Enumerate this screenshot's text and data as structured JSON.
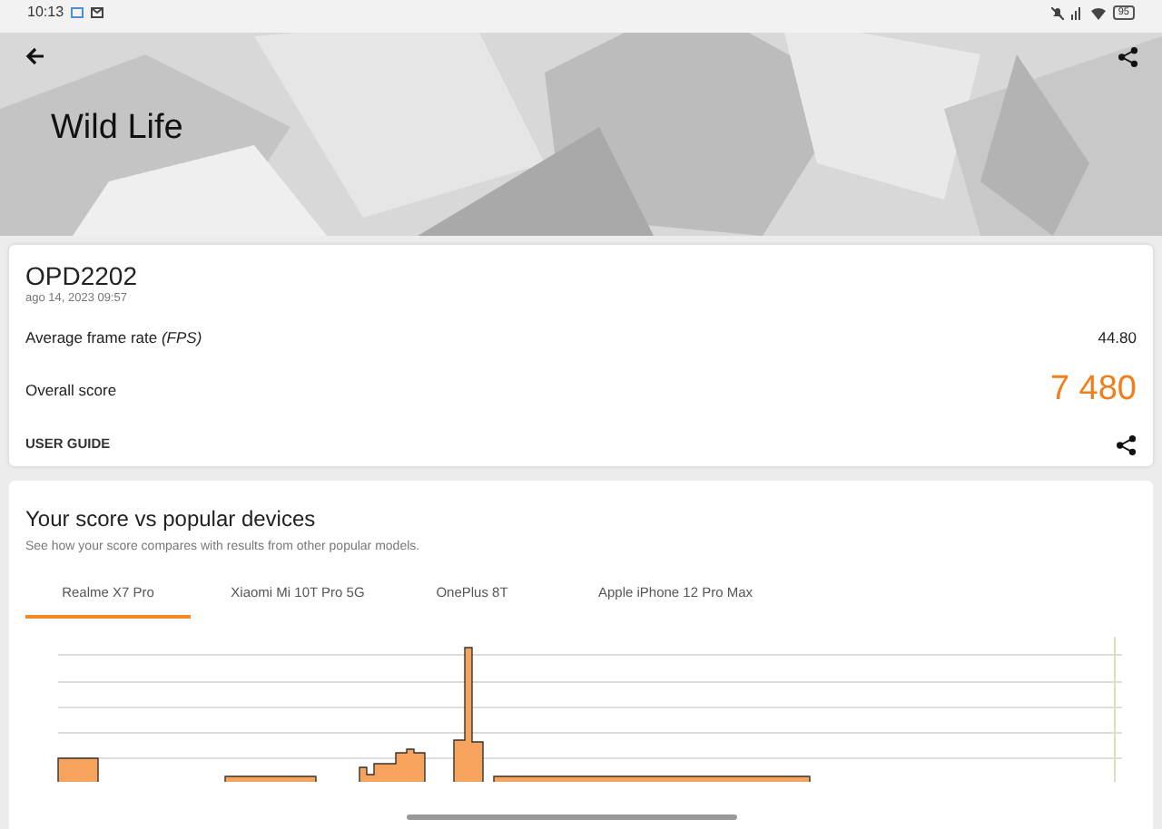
{
  "status_bar": {
    "time": "10:13",
    "battery": "95"
  },
  "header": {
    "title": "Wild Life"
  },
  "result": {
    "device": "OPD2202",
    "date": "ago 14, 2023 09:57",
    "metrics": [
      {
        "kind": "fps",
        "label": "Average frame rate *(FPS)*",
        "value": "44.80"
      },
      {
        "kind": "score",
        "label": "Overall score",
        "value": "7 480"
      }
    ],
    "link": "USER GUIDE"
  },
  "comparison": {
    "title": "Your score vs popular devices",
    "subtitle": "See how your score compares with results from other popular models.",
    "tabs": [
      {
        "label": "Realme X7 Pro",
        "selected": true
      },
      {
        "label": "Xiaomi Mi 10T Pro 5G",
        "selected": false
      },
      {
        "label": "OnePlus 8T",
        "selected": false
      },
      {
        "label": "Apple iPhone 12 Pro Max",
        "selected": false
      }
    ]
  }
}
